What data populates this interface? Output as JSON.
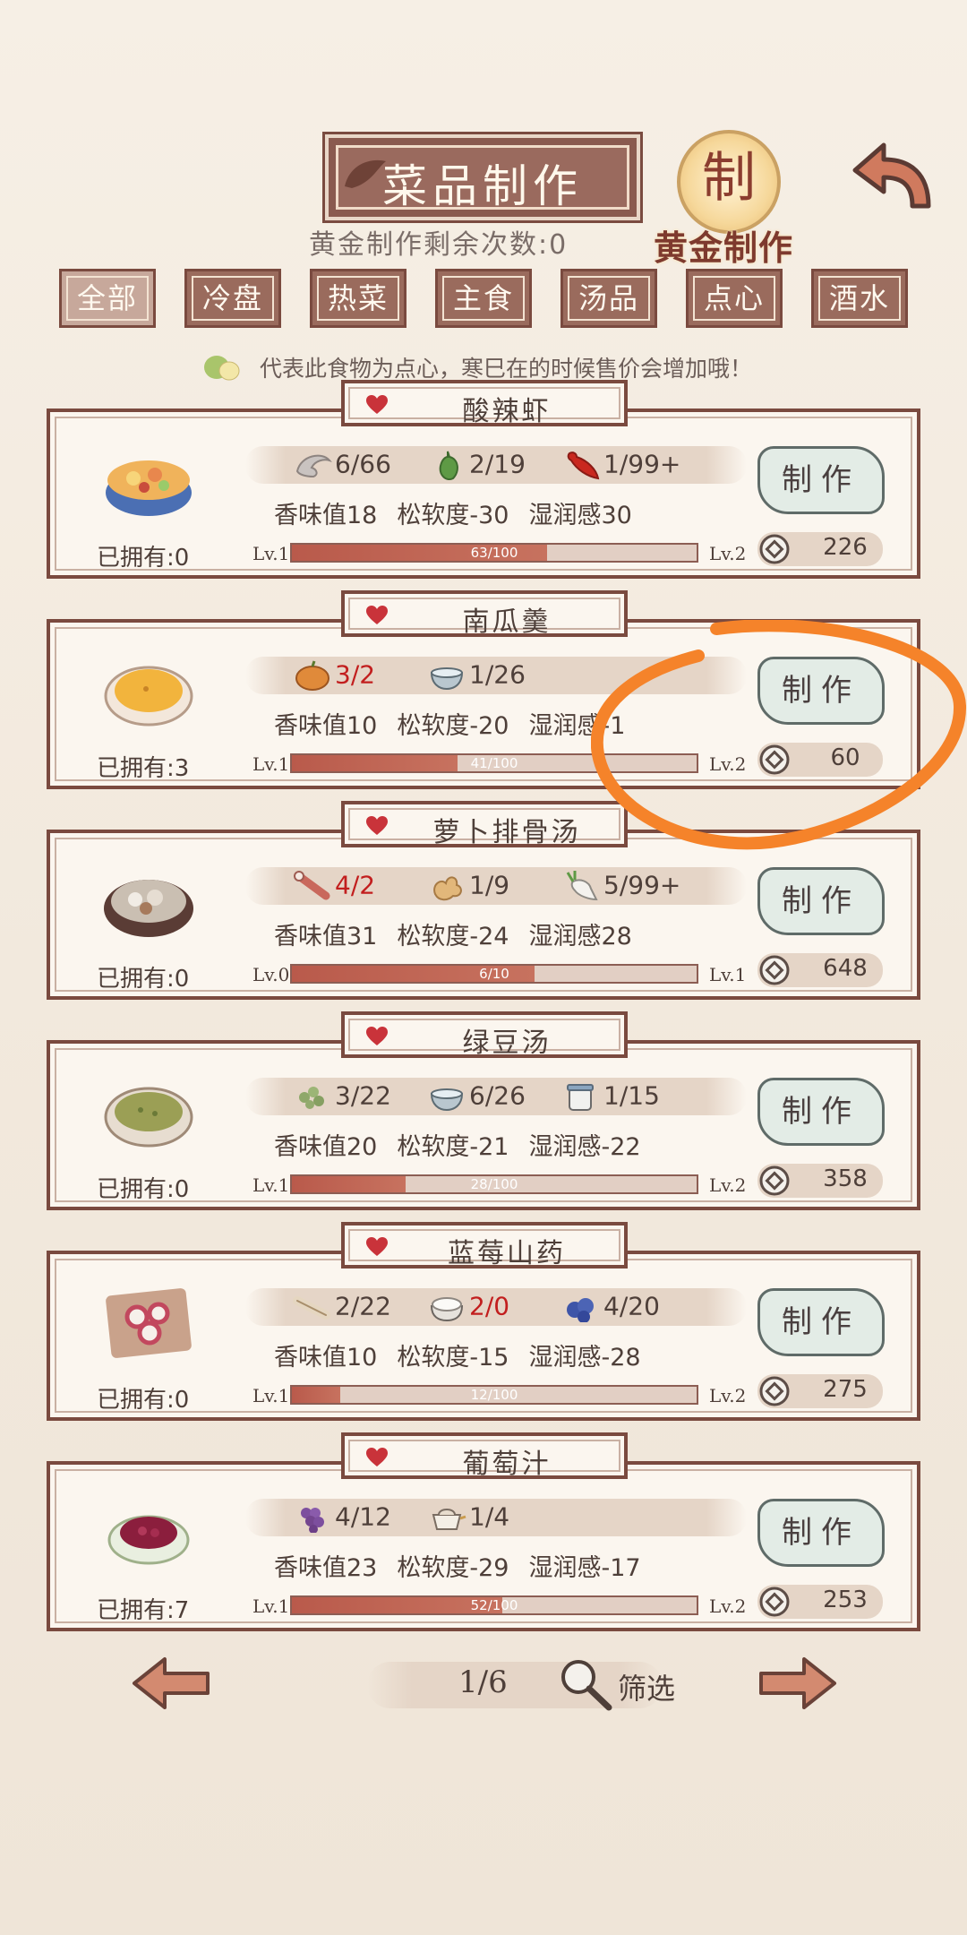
{
  "header": {
    "title": "菜品制作",
    "gold_remaining": "黄金制作剩余次数:0",
    "gold_badge_char": "制",
    "gold_label": "黄金制作"
  },
  "tabs": [
    {
      "label": "全部",
      "active": true
    },
    {
      "label": "冷盘",
      "active": false
    },
    {
      "label": "热菜",
      "active": false
    },
    {
      "label": "主食",
      "active": false
    },
    {
      "label": "汤品",
      "active": false
    },
    {
      "label": "点心",
      "active": false
    },
    {
      "label": "酒水",
      "active": false
    }
  ],
  "hint": "代表此食物为点心，寒巳在的时候售价会增加哦！",
  "cards": [
    {
      "name": "酸辣虾",
      "owned": "已拥有:0",
      "ingredients": [
        {
          "icon": "shrimp-icon",
          "count": "6/66",
          "red": false
        },
        {
          "icon": "green-pepper-icon",
          "count": "2/19",
          "red": false
        },
        {
          "icon": "red-chili-icon",
          "count": "1/99+",
          "red": false
        }
      ],
      "stats": [
        "香味值18",
        "松软度-30",
        "湿润感30"
      ],
      "lv_from": "Lv.1",
      "lv_to": "Lv.2",
      "progress": "63/100",
      "progress_fraction": 0.63,
      "make_label": "制作",
      "price": "226"
    },
    {
      "name": "南瓜羹",
      "owned": "已拥有:3",
      "ingredients": [
        {
          "icon": "pumpkin-icon",
          "count": "3/2",
          "red": true
        },
        {
          "icon": "bowl-icon",
          "count": "1/26",
          "red": false
        }
      ],
      "stats": [
        "香味值10",
        "松软度-20",
        "湿润感-1"
      ],
      "lv_from": "Lv.1",
      "lv_to": "Lv.2",
      "progress": "41/100",
      "progress_fraction": 0.41,
      "make_label": "制作",
      "price": "60"
    },
    {
      "name": "萝卜排骨汤",
      "owned": "已拥有:0",
      "ingredients": [
        {
          "icon": "rib-icon",
          "count": "4/2",
          "red": true
        },
        {
          "icon": "ginger-icon",
          "count": "1/9",
          "red": false
        },
        {
          "icon": "radish-icon",
          "count": "5/99+",
          "red": false
        }
      ],
      "stats": [
        "香味值31",
        "松软度-24",
        "湿润感28"
      ],
      "lv_from": "Lv.0",
      "lv_to": "Lv.1",
      "progress": "6/10",
      "progress_fraction": 0.6,
      "make_label": "制作",
      "price": "648"
    },
    {
      "name": "绿豆汤",
      "owned": "已拥有:0",
      "ingredients": [
        {
          "icon": "mung-bean-icon",
          "count": "3/22",
          "red": false
        },
        {
          "icon": "bowl-icon",
          "count": "6/26",
          "red": false
        },
        {
          "icon": "sugar-jar-icon",
          "count": "1/15",
          "red": false
        }
      ],
      "stats": [
        "香味值20",
        "松软度-21",
        "湿润感-22"
      ],
      "lv_from": "Lv.1",
      "lv_to": "Lv.2",
      "progress": "28/100",
      "progress_fraction": 0.28,
      "make_label": "制作",
      "price": "358"
    },
    {
      "name": "蓝莓山药",
      "owned": "已拥有:0",
      "ingredients": [
        {
          "icon": "yam-icon",
          "count": "2/22",
          "red": false
        },
        {
          "icon": "rice-bowl-icon",
          "count": "2/0",
          "red": true
        },
        {
          "icon": "blueberry-icon",
          "count": "4/20",
          "red": false
        }
      ],
      "stats": [
        "香味值10",
        "松软度-15",
        "湿润感-28"
      ],
      "lv_from": "Lv.1",
      "lv_to": "Lv.2",
      "progress": "12/100",
      "progress_fraction": 0.12,
      "make_label": "制作",
      "price": "275"
    },
    {
      "name": "葡萄汁",
      "owned": "已拥有:7",
      "ingredients": [
        {
          "icon": "grape-icon",
          "count": "4/12",
          "red": false
        },
        {
          "icon": "pot-icon",
          "count": "1/4",
          "red": false
        }
      ],
      "stats": [
        "香味值23",
        "松软度-29",
        "湿润感-17"
      ],
      "lv_from": "Lv.1",
      "lv_to": "Lv.2",
      "progress": "52/100",
      "progress_fraction": 0.52,
      "make_label": "制作",
      "price": "253"
    }
  ],
  "footer": {
    "page": "1/6",
    "filter_label": "筛选"
  },
  "colors": {
    "frame": "#7a4a3f",
    "tab_bg": "#9a6b5d",
    "bar_fill": "#b95a4b",
    "red_count": "#c21e1e",
    "annotation": "#f5832a"
  }
}
